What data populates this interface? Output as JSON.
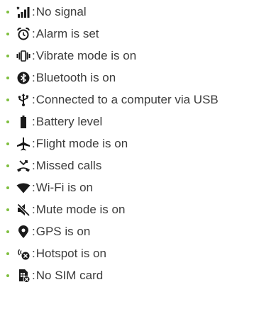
{
  "items": [
    {
      "icon": "no-signal-icon",
      "label": "No signal"
    },
    {
      "icon": "alarm-icon",
      "label": "Alarm is set"
    },
    {
      "icon": "vibrate-icon",
      "label": "Vibrate mode is on"
    },
    {
      "icon": "bluetooth-icon",
      "label": "Bluetooth is on"
    },
    {
      "icon": "usb-icon",
      "label": "Connected to a computer via USB"
    },
    {
      "icon": "battery-icon",
      "label": "Battery level"
    },
    {
      "icon": "airplane-icon",
      "label": "Flight mode is on"
    },
    {
      "icon": "missed-call-icon",
      "label": "Missed calls"
    },
    {
      "icon": "wifi-icon",
      "label": "Wi-Fi is on"
    },
    {
      "icon": "mute-icon",
      "label": "Mute mode is on"
    },
    {
      "icon": "gps-icon",
      "label": "GPS is on"
    },
    {
      "icon": "hotspot-icon",
      "label": "Hotspot is on"
    },
    {
      "icon": "no-sim-icon",
      "label": "No SIM card"
    }
  ],
  "separator": ":",
  "colors": {
    "bullet": "#7fbf3f",
    "icon": "#1a1a1a",
    "text": "#3c3c3c"
  }
}
